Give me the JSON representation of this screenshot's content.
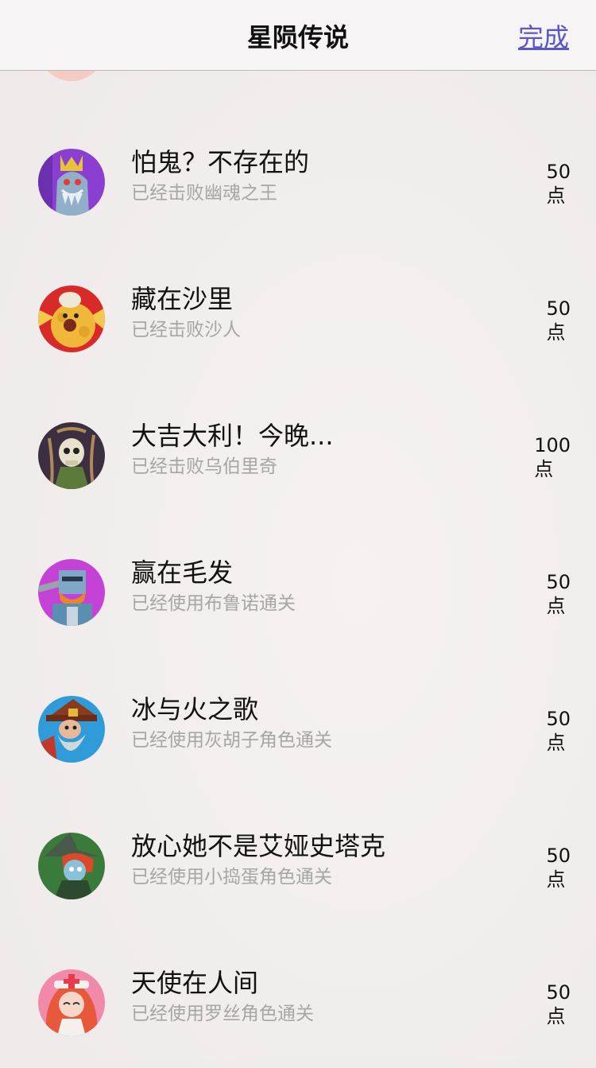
{
  "nav": {
    "title": "星陨传说",
    "done_label": "完成"
  },
  "achievements": [
    {
      "title": "怕鬼？不存在的",
      "subtitle": "已经击败幽魂之王",
      "points": "50",
      "unit": "点",
      "avatar_icon": "ghost-king-avatar-icon",
      "avatar_color": "#8a3fd1"
    },
    {
      "title": "藏在沙里",
      "subtitle": "已经击败沙人",
      "points": "50",
      "unit": "点",
      "avatar_icon": "sandman-avatar-icon",
      "avatar_color": "#d92a2a"
    },
    {
      "title": "大吉大利！今晚...",
      "subtitle": "已经击败乌伯里奇",
      "points": "100",
      "unit": "点",
      "avatar_icon": "skull-avatar-icon",
      "avatar_color": "#3b2f40"
    },
    {
      "title": "赢在毛发",
      "subtitle": "已经使用布鲁诺通关",
      "points": "50",
      "unit": "点",
      "avatar_icon": "bruno-avatar-icon",
      "avatar_color": "#c443d6"
    },
    {
      "title": "冰与火之歌",
      "subtitle": "已经使用灰胡子角色通关",
      "points": "50",
      "unit": "点",
      "avatar_icon": "greybeard-avatar-icon",
      "avatar_color": "#2f9bd8"
    },
    {
      "title": "放心她不是艾娅史塔克",
      "subtitle": "已经使用小捣蛋角色通关",
      "points": "50",
      "unit": "点",
      "avatar_icon": "witch-avatar-icon",
      "avatar_color": "#3a7a3a"
    },
    {
      "title": "天使在人间",
      "subtitle": "已经使用罗丝角色通关",
      "points": "50",
      "unit": "点",
      "avatar_icon": "rose-avatar-icon",
      "avatar_color": "#f08aa8"
    }
  ]
}
